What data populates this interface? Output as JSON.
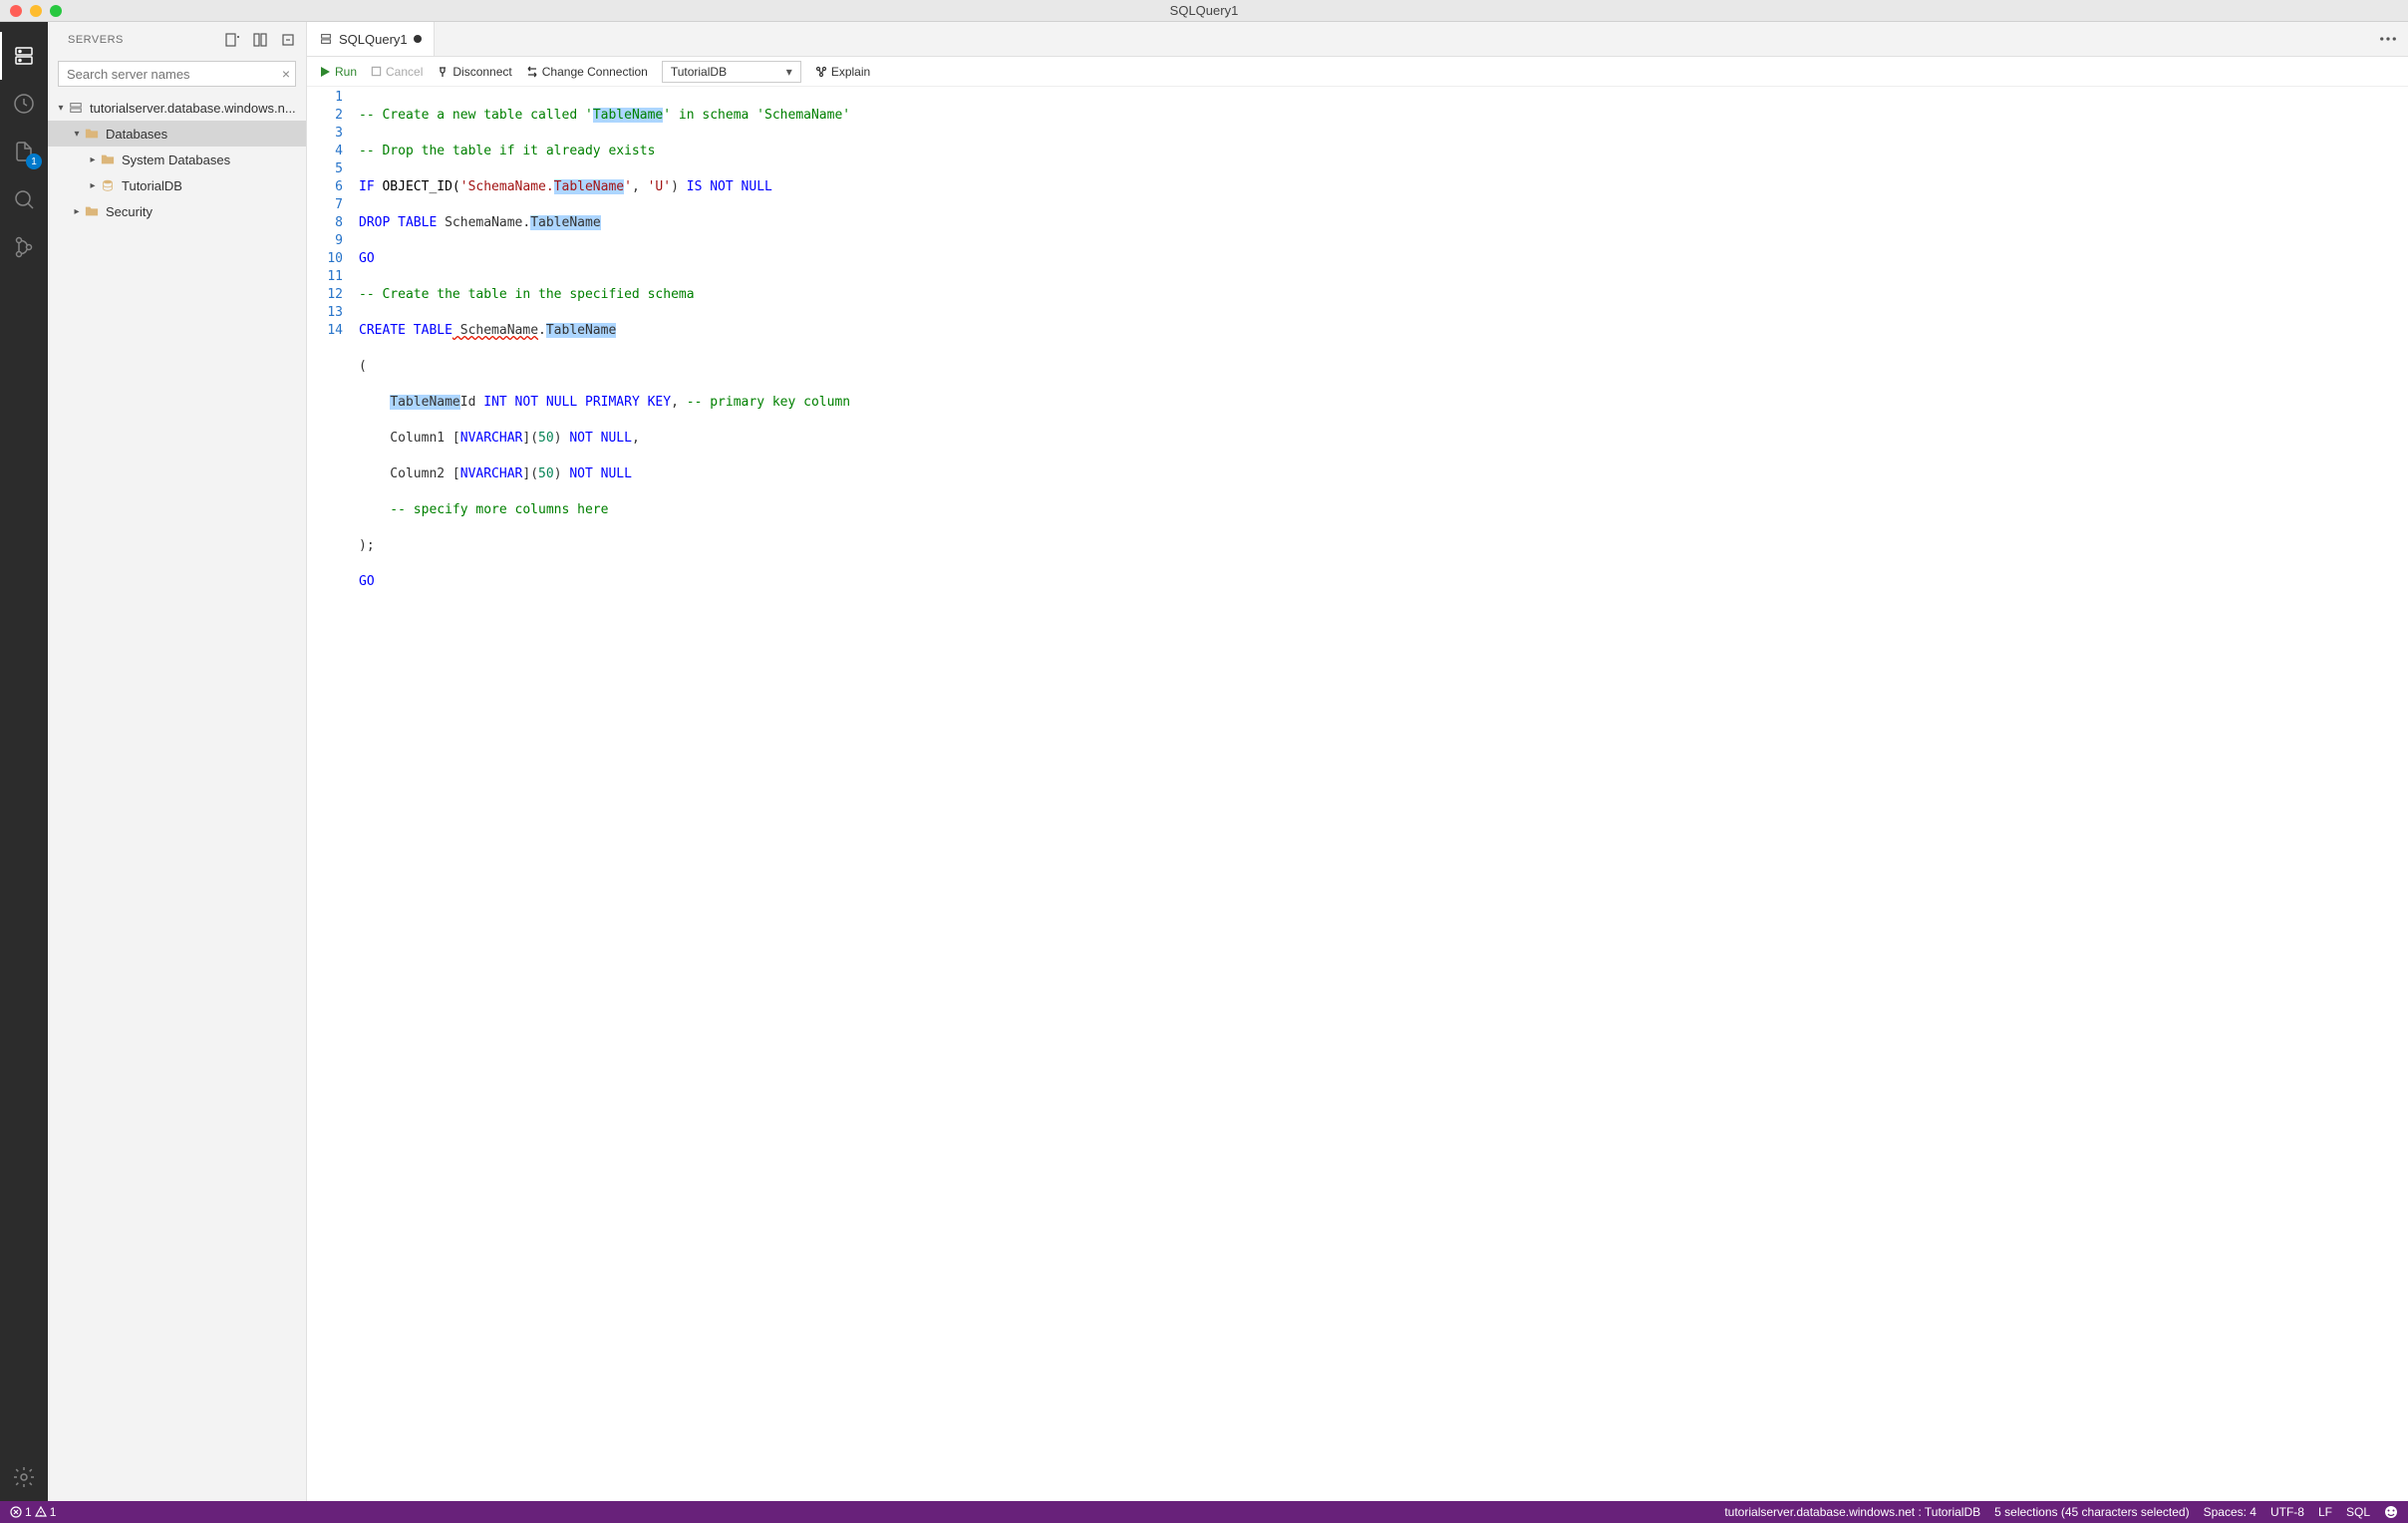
{
  "window": {
    "title": "SQLQuery1"
  },
  "activitybar": {
    "badge": "1"
  },
  "sidebar": {
    "title": "SERVERS",
    "search_placeholder": "Search server names",
    "tree": {
      "server": "tutorialserver.database.windows.n...",
      "databases": "Databases",
      "system_databases": "System Databases",
      "tutorialdb": "TutorialDB",
      "security": "Security"
    }
  },
  "tab": {
    "label": "SQLQuery1"
  },
  "toolbar": {
    "run": "Run",
    "cancel": "Cancel",
    "disconnect": "Disconnect",
    "change_connection": "Change Connection",
    "db": "TutorialDB",
    "explain": "Explain"
  },
  "code": {
    "lines": 14,
    "l1_a": "-- Create a new table called '",
    "l1_hl": "TableName",
    "l1_b": "' in schema '",
    "l1_c": "SchemaName",
    "l1_d": "'",
    "l2": "-- Drop the table if it already exists",
    "l3_if": "IF",
    "l3_obj": " OBJECT_ID(",
    "l3_s1": "'SchemaName.",
    "l3_hl": "TableName",
    "l3_s1b": "'",
    "l3_c": ", ",
    "l3_s2": "'U'",
    "l3_p": ") ",
    "l3_k": "IS NOT NULL",
    "l4_a": "DROP TABLE",
    "l4_b": " SchemaName.",
    "l4_hl": "TableName",
    "l5": "GO",
    "l6": "-- Create the table in the specified schema",
    "l7_a": "CREATE TABLE",
    "l7_b": " SchemaName",
    "l7_dot": ".",
    "l7_hl": "TableName",
    "l8": "(",
    "l9_indent": "    ",
    "l9_hl": "TableName",
    "l9_id": "Id ",
    "l9_k": "INT NOT NULL PRIMARY KEY",
    "l9_c": ", ",
    "l9_cm": "-- primary key column",
    "l10_a": "    Column1 [",
    "l10_t": "NVARCHAR",
    "l10_b": "](",
    "l10_n": "50",
    "l10_c": ") ",
    "l10_k": "NOT NULL",
    "l10_d": ",",
    "l11_a": "    Column2 [",
    "l11_t": "NVARCHAR",
    "l11_b": "](",
    "l11_n": "50",
    "l11_c": ") ",
    "l11_k": "NOT NULL",
    "l12": "    -- specify more columns here",
    "l13": ");",
    "l14": "GO"
  },
  "statusbar": {
    "errors": "1",
    "warnings": "1",
    "connection": "tutorialserver.database.windows.net : TutorialDB",
    "selections": "5 selections (45 characters selected)",
    "spaces": "Spaces: 4",
    "encoding": "UTF-8",
    "eol": "LF",
    "language": "SQL"
  }
}
